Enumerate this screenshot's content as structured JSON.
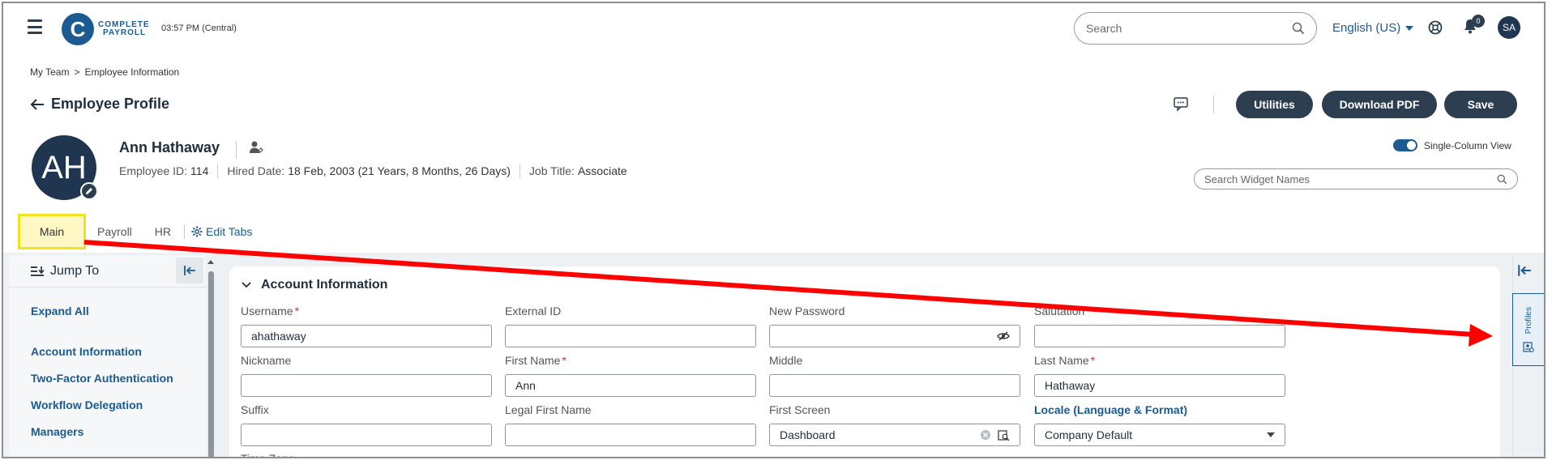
{
  "header": {
    "logo_letter": "C",
    "logo_line1": "COMPLETE",
    "logo_line2": "PAYROLL",
    "clock": "03:57 PM (Central)",
    "search_placeholder": "Search",
    "language": "English (US)",
    "notification_count": "0",
    "user_initials": "SA"
  },
  "breadcrumb": {
    "items": [
      "My Team",
      "Employee Information"
    ],
    "separator": ">"
  },
  "page": {
    "title": "Employee Profile"
  },
  "actions": {
    "utilities": "Utilities",
    "download_pdf": "Download PDF",
    "save": "Save"
  },
  "employee": {
    "initials": "AH",
    "name": "Ann Hathaway",
    "id_label": "Employee ID:",
    "id_value": "114",
    "hired_label": "Hired Date:",
    "hired_value": "18 Feb, 2003 (21 Years, 8 Months, 26 Days)",
    "job_label": "Job Title:",
    "job_value": "Associate"
  },
  "view": {
    "single_column_label": "Single-Column View",
    "single_column_enabled": true,
    "widget_search_placeholder": "Search Widget Names"
  },
  "tabs": {
    "items": [
      {
        "label": "Main",
        "active": true
      },
      {
        "label": "Payroll",
        "active": false
      },
      {
        "label": "HR",
        "active": false
      }
    ],
    "edit_label": "Edit Tabs"
  },
  "sidebar": {
    "title": "Jump To",
    "expand_all": "Expand All",
    "links": [
      "Account Information",
      "Two-Factor Authentication",
      "Workflow Delegation",
      "Managers"
    ]
  },
  "section": {
    "title": "Account Information",
    "fields": {
      "username": {
        "label": "Username",
        "value": "ahathaway",
        "required": true
      },
      "external_id": {
        "label": "External ID",
        "value": ""
      },
      "new_password": {
        "label": "New Password",
        "value": ""
      },
      "salutation": {
        "label": "Salutation",
        "value": ""
      },
      "nickname": {
        "label": "Nickname",
        "value": ""
      },
      "first_name": {
        "label": "First Name",
        "value": "Ann",
        "required": true
      },
      "middle": {
        "label": "Middle",
        "value": ""
      },
      "last_name": {
        "label": "Last Name",
        "value": "Hathaway",
        "required": true
      },
      "suffix": {
        "label": "Suffix",
        "value": ""
      },
      "legal_first_name": {
        "label": "Legal First Name",
        "value": ""
      },
      "first_screen": {
        "label": "First Screen",
        "value": "Dashboard"
      },
      "locale": {
        "label": "Locale (Language & Format)",
        "value": "Company Default"
      },
      "time_zone": {
        "label": "Time Zone"
      }
    },
    "required_marker": "*"
  },
  "right_rail": {
    "profiles_label": "Profiles"
  },
  "colors": {
    "brand": "#1c5a92",
    "dark_button": "#2c3e50",
    "highlight_box": "#f2e21b",
    "annotation_arrow": "#ff0000"
  }
}
